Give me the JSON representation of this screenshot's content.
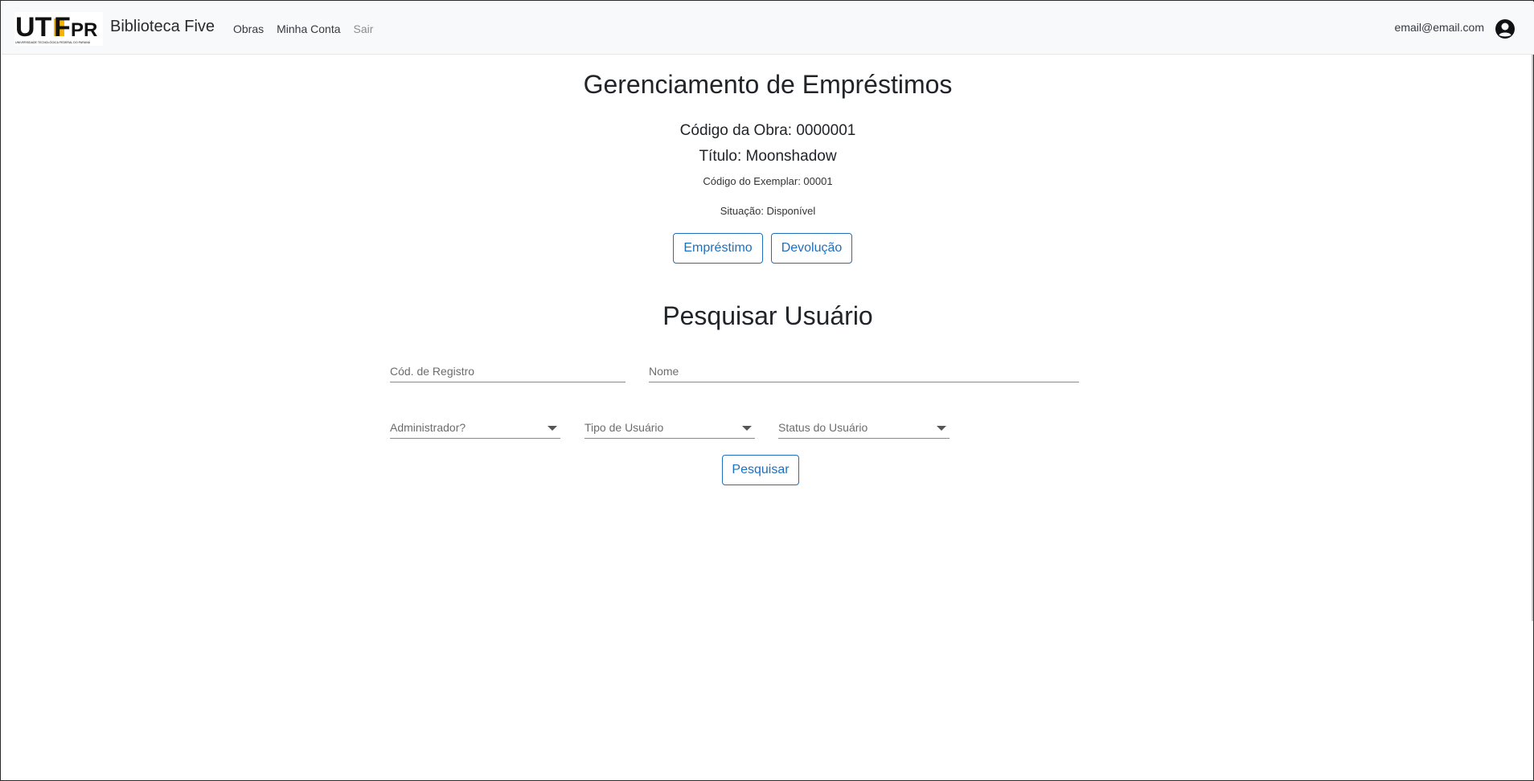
{
  "navbar": {
    "logo_text": "UTFPR",
    "logo_subtext": "UNIVERSIDADE TECNOLÓGICA FEDERAL DO PARANÁ",
    "brand": "Biblioteca Five",
    "links": [
      "Obras",
      "Minha Conta",
      "Sair"
    ],
    "user_email": "email@email.com",
    "account_icon": "account-circle-icon"
  },
  "loan": {
    "title": "Gerenciamento de Empréstimos",
    "obra_code": "Código da Obra: 0000001",
    "obra_title": "Título: Moonshadow",
    "exemplar_code": "Código do Exemplar: 00001",
    "situacao": "Situação: Disponível",
    "btn_emprestimo": "Empréstimo",
    "btn_devolucao": "Devolução"
  },
  "search": {
    "title": "Pesquisar Usuário",
    "cod_registro_placeholder": "Cód. de Registro",
    "nome_placeholder": "Nome",
    "administrador_placeholder": "Administrador?",
    "tipo_placeholder": "Tipo de Usuário",
    "status_placeholder": "Status do Usuário",
    "btn_pesquisar": "Pesquisar"
  },
  "colors": {
    "accent": "#1f6fbf",
    "navbar_bg": "#f8f9fa",
    "logo_yellow": "#f5b400"
  }
}
